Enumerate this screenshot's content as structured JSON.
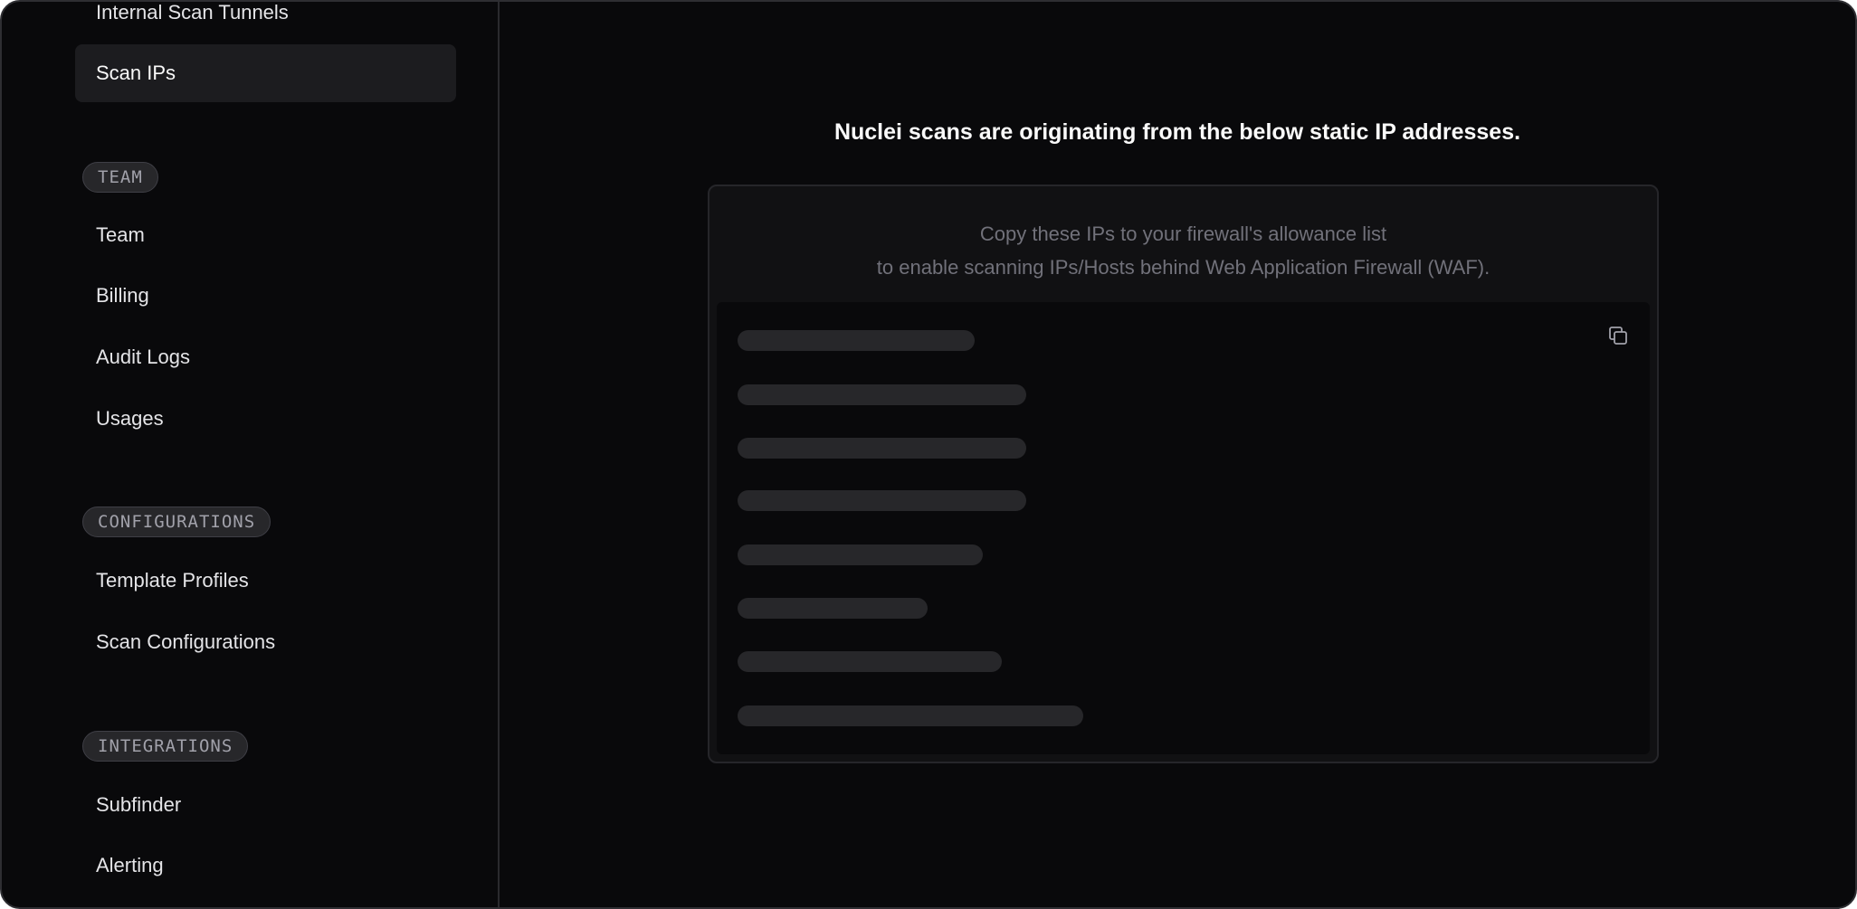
{
  "sidebar": {
    "items_top": [
      {
        "label": "Internal Scan Tunnels"
      },
      {
        "label": "Scan IPs"
      }
    ],
    "sections": [
      {
        "tag": "TEAM",
        "items": [
          {
            "label": "Team"
          },
          {
            "label": "Billing"
          },
          {
            "label": "Audit Logs"
          },
          {
            "label": "Usages"
          }
        ]
      },
      {
        "tag": "CONFIGURATIONS",
        "items": [
          {
            "label": "Template Profiles"
          },
          {
            "label": "Scan Configurations"
          }
        ]
      },
      {
        "tag": "INTEGRATIONS",
        "items": [
          {
            "label": "Subfinder"
          },
          {
            "label": "Alerting"
          }
        ]
      }
    ]
  },
  "main": {
    "headline": "Nuclei scans are originating from the below static IP addresses.",
    "card": {
      "description_line1": "Copy these IPs to your firewall's allowance list",
      "description_line2": "to enable scanning IPs/Hosts behind Web Application Firewall (WAF).",
      "copy_icon": "copy-icon",
      "ip_placeholders_loading": 8
    }
  },
  "colors": {
    "background": "#09090b",
    "active_item": "#1c1c1f",
    "skeleton": "#27272a",
    "muted_text": "#71717a"
  }
}
